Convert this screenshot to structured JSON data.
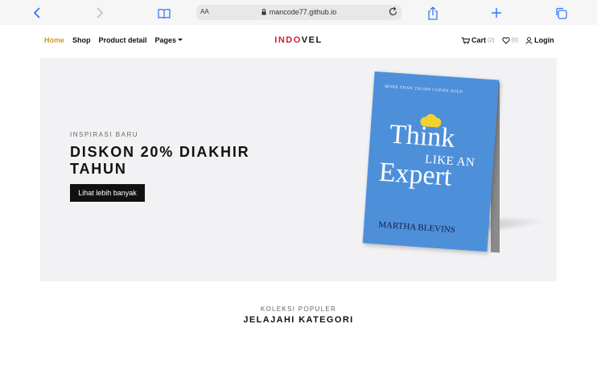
{
  "browser": {
    "url_aa": "AA",
    "url": "mancode77.github.io",
    "icons": [
      "back-icon",
      "forward-icon",
      "book-icon",
      "lock-icon",
      "reload-icon",
      "share-icon",
      "plus-icon",
      "tabs-icon"
    ]
  },
  "nav": {
    "links": [
      {
        "label": "Home",
        "active": true
      },
      {
        "label": "Shop"
      },
      {
        "label": "Product detail"
      },
      {
        "label": "Pages"
      }
    ],
    "brand_part1": "INDO",
    "brand_part2": "VEL",
    "cart_label": "Cart",
    "cart_count": "(2)",
    "wishlist_count": "(0)",
    "login_label": "Login"
  },
  "hero": {
    "eyebrow": "INSPIRASI BARU",
    "headline": "DISKON 20% DIAKHIR TAHUN",
    "cta": "Lihat lebih banyak",
    "book": {
      "tagline": "MORE THAN 250,000 COPIES SOLD",
      "title_line1": "Think",
      "title_line2": "LIKE AN",
      "title_line3": "Expert",
      "author": "MARTHA BLEVINS"
    }
  },
  "section": {
    "eyebrow": "KOLEKSI POPULER",
    "title": "JELAJAHI KATEGORI"
  },
  "colors": {
    "accent": "#c99b2f",
    "brand_red": "#d0202a",
    "book_blue": "#4e8fda",
    "hero_bg": "#f2f2f4"
  }
}
